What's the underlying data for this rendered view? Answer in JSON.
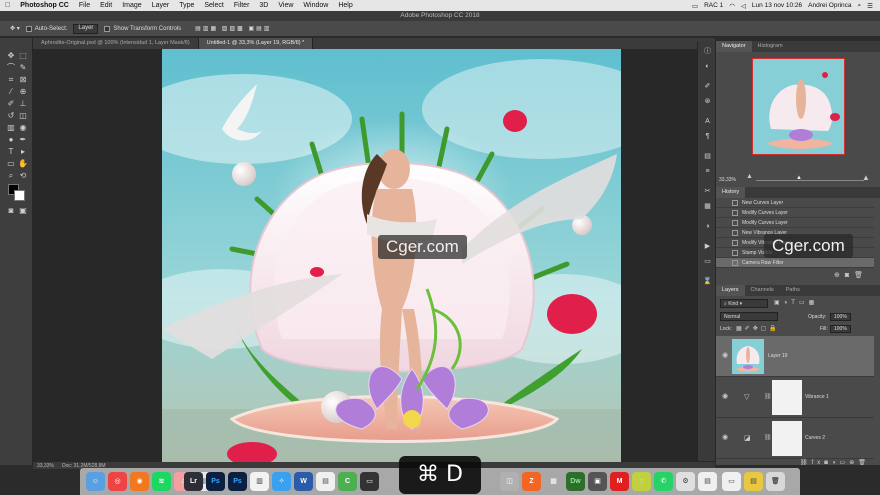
{
  "menubar": {
    "apple": "",
    "app": "Photoshop CC",
    "items": [
      "File",
      "Edit",
      "Image",
      "Layer",
      "Type",
      "Select",
      "Filter",
      "3D",
      "View",
      "Window",
      "Help"
    ],
    "status_rac": "RAC 1",
    "datetime": "Lun 13 nov  10:26",
    "user": "Andrei Oprinca"
  },
  "window_title": "Adobe Photoshop CC 2018",
  "options": {
    "auto_select": "Auto-Select:",
    "auto_select_value": "Layer",
    "show_transform": "Show Transform Controls"
  },
  "tabs": [
    "Aphrodite-Original.psd @ 100% (Intensidad 1, Layer Mask/8)",
    "Untitled-1 @ 33,3% (Layer 19, RGB/8) *"
  ],
  "status": {
    "zoom": "33,33%",
    "doc": "Doc: 31,2M/528,8M"
  },
  "navigator": {
    "tabs": [
      "Navigator",
      "Histogram"
    ],
    "zoom": "33,33%"
  },
  "history": {
    "title": "History",
    "items": [
      "New Curves Layer",
      "Modify Curves Layer",
      "Modify Curves Layer",
      "New Vibrance Layer",
      "Modify Vibrance Layer",
      "Stamp Visible",
      "Camera Raw Filter"
    ]
  },
  "layers": {
    "tabs": [
      "Layers",
      "Channels",
      "Paths"
    ],
    "kind": "Kind",
    "blend_mode": "Normal",
    "opacity_label": "Opacity:",
    "opacity_value": "100%",
    "lock_label": "Lock:",
    "fill_label": "Fill:",
    "fill_value": "100%",
    "rows": [
      {
        "name": "Layer 19",
        "type": "image"
      },
      {
        "name": "Vibrance 1",
        "type": "adjustment"
      },
      {
        "name": "Curves 2",
        "type": "adjustment"
      }
    ]
  },
  "watermarks": [
    "Cger.com",
    "Cger.com"
  ],
  "shortcut": "⌘ D",
  "dock": {
    "labels": [
      "Lr",
      "Ps",
      "Ps",
      "Dw"
    ]
  },
  "colors": {
    "sky": "#6fc6d1",
    "shell": "#f0dfe6",
    "petal": "#e0204a",
    "accent": "#31a8ff"
  }
}
